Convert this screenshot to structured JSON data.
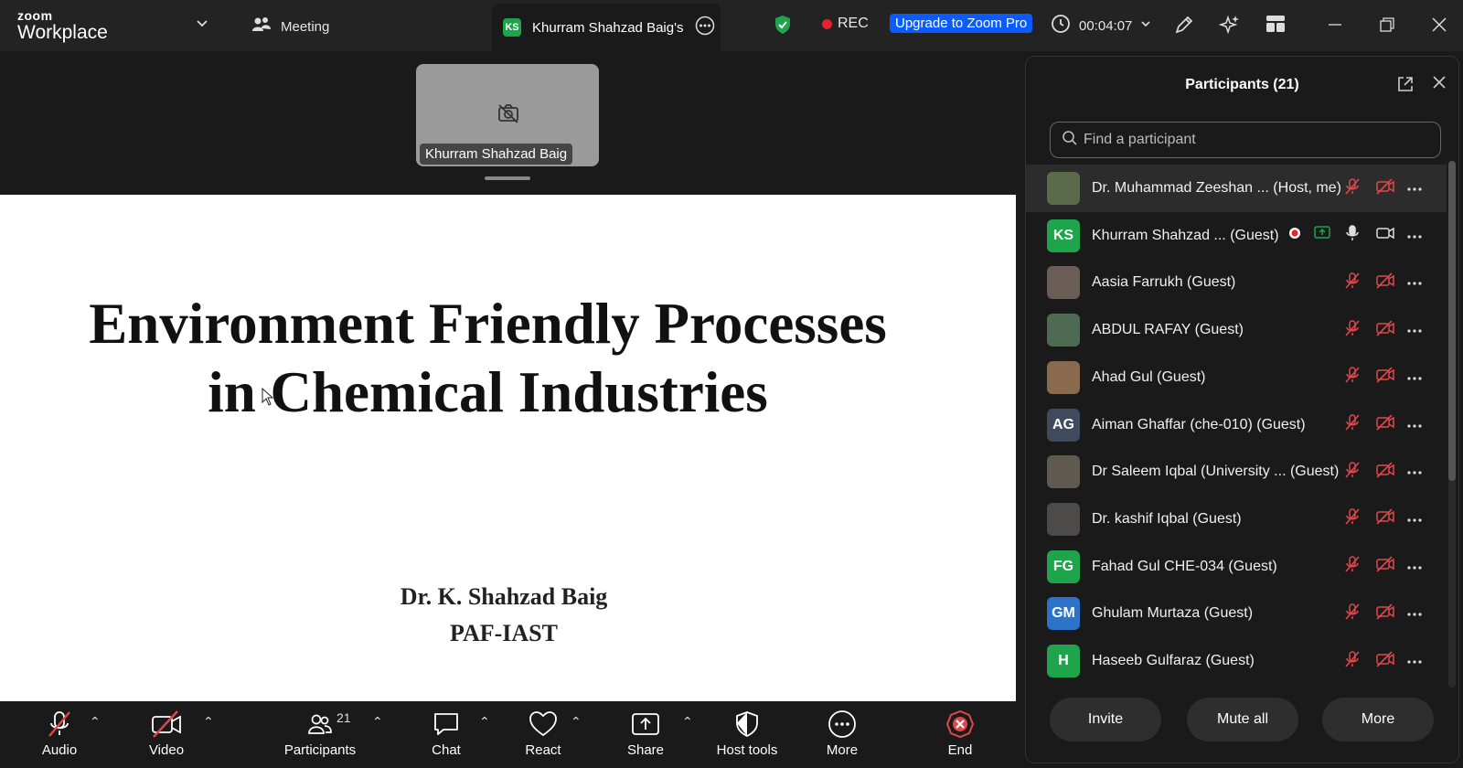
{
  "app": {
    "logo_line1": "zoom",
    "logo_line2": "Workplace"
  },
  "topbar": {
    "meeting_label": "Meeting",
    "active_tab_initials": "KS",
    "active_tab_title": "Khurram Shahzad Baig's s",
    "rec_label": "REC",
    "upgrade_label": "Upgrade to Zoom Pro",
    "timer": "00:04:07"
  },
  "stage": {
    "thumbnail_name": "Khurram Shahzad Baig",
    "slide_title_line1": "Environment Friendly Processes",
    "slide_title_line2": "in Chemical Industries",
    "slide_author": "Dr. K. Shahzad Baig",
    "slide_affiliation": "PAF-IAST"
  },
  "bottombar": {
    "audio": "Audio",
    "video": "Video",
    "participants": "Participants",
    "participants_count": "21",
    "chat": "Chat",
    "react": "React",
    "share": "Share",
    "host_tools": "Host tools",
    "more": "More",
    "end": "End"
  },
  "panel": {
    "title": "Participants (21)",
    "search_placeholder": "Find a participant",
    "participants": [
      {
        "name": "Dr. Muhammad Zeeshan ... (Host, me)",
        "initials": "",
        "avatar_color": "#5b6b4a"
      },
      {
        "name": "Khurram Shahzad ... (Guest)",
        "initials": "KS",
        "avatar_color": "#1ea44b"
      },
      {
        "name": "Aasia Farrukh (Guest)",
        "initials": "",
        "avatar_color": "#6a5d55"
      },
      {
        "name": "ABDUL RAFAY (Guest)",
        "initials": "",
        "avatar_color": "#4f6a52"
      },
      {
        "name": "Ahad Gul (Guest)",
        "initials": "",
        "avatar_color": "#8a6a4f"
      },
      {
        "name": "Aiman Ghaffar (che-010) (Guest)",
        "initials": "AG",
        "avatar_color": "#3f4a5c"
      },
      {
        "name": "Dr Saleem Iqbal (University ... (Guest)",
        "initials": "",
        "avatar_color": "#5f5a50"
      },
      {
        "name": "Dr. kashif Iqbal (Guest)",
        "initials": "",
        "avatar_color": "#4d4a4a"
      },
      {
        "name": "Fahad Gul CHE-034 (Guest)",
        "initials": "FG",
        "avatar_color": "#1ea44b"
      },
      {
        "name": "Ghulam Murtaza (Guest)",
        "initials": "GM",
        "avatar_color": "#2a73c9"
      },
      {
        "name": "Haseeb Gulfaraz (Guest)",
        "initials": "H",
        "avatar_color": "#1ea44b"
      },
      {
        "name": "",
        "initials": "",
        "avatar_color": "#7a3fb8"
      }
    ],
    "invite": "Invite",
    "mute_all": "Mute all",
    "more": "More"
  },
  "colors": {
    "accent_blue": "#0b5cff",
    "rec_red": "#e8212b",
    "muted_red": "#e0474c",
    "shield_green": "#1ea44b"
  }
}
